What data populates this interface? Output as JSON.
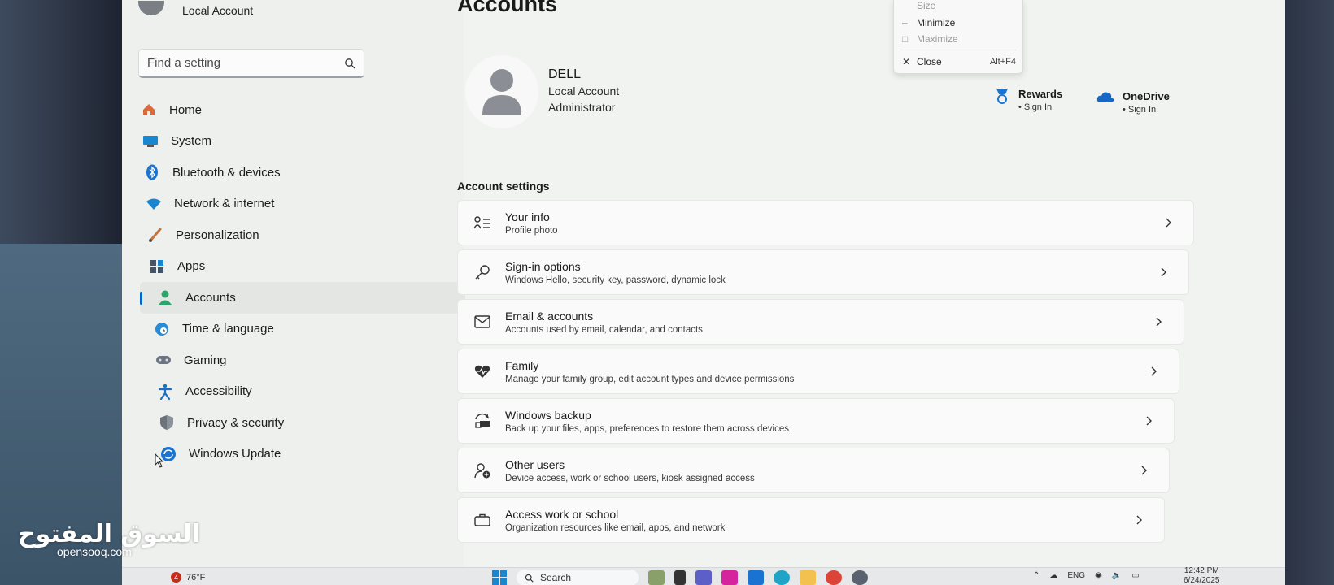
{
  "header_account": {
    "label": "Local Account"
  },
  "search": {
    "placeholder": "Find a setting"
  },
  "nav": {
    "items": [
      {
        "label": "Home",
        "icon": "home-icon"
      },
      {
        "label": "System",
        "icon": "monitor-icon"
      },
      {
        "label": "Bluetooth & devices",
        "icon": "bluetooth-icon"
      },
      {
        "label": "Network & internet",
        "icon": "wifi-icon"
      },
      {
        "label": "Personalization",
        "icon": "brush-icon"
      },
      {
        "label": "Apps",
        "icon": "apps-icon"
      },
      {
        "label": "Accounts",
        "icon": "person-icon",
        "active": true
      },
      {
        "label": "Time & language",
        "icon": "globe-clock-icon"
      },
      {
        "label": "Gaming",
        "icon": "gamepad-icon"
      },
      {
        "label": "Accessibility",
        "icon": "accessibility-icon"
      },
      {
        "label": "Privacy & security",
        "icon": "shield-icon"
      },
      {
        "label": "Windows Update",
        "icon": "refresh-icon"
      }
    ]
  },
  "page": {
    "title": "Accounts"
  },
  "profile": {
    "name": "DELL",
    "type": "Local Account",
    "role": "Administrator"
  },
  "services": [
    {
      "title": "Rewards",
      "subtitle": "• Sign In",
      "icon": "rewards-medal-icon"
    },
    {
      "title": "OneDrive",
      "subtitle": "• Sign In",
      "icon": "cloud-icon"
    }
  ],
  "section": {
    "title": "Account settings"
  },
  "cards": [
    {
      "title": "Your info",
      "subtitle": "Profile photo",
      "icon": "person-details-icon"
    },
    {
      "title": "Sign-in options",
      "subtitle": "Windows Hello, security key, password, dynamic lock",
      "icon": "key-icon"
    },
    {
      "title": "Email & accounts",
      "subtitle": "Accounts used by email, calendar, and contacts",
      "icon": "mail-icon"
    },
    {
      "title": "Family",
      "subtitle": "Manage your family group, edit account types and device permissions",
      "icon": "heart-family-icon"
    },
    {
      "title": "Windows backup",
      "subtitle": "Back up your files, apps, preferences to restore them across devices",
      "icon": "backup-icon"
    },
    {
      "title": "Other users",
      "subtitle": "Device access, work or school users, kiosk assigned access",
      "icon": "add-user-icon"
    },
    {
      "title": "Access work or school",
      "subtitle": "Organization resources like email, apps, and network",
      "icon": "briefcase-icon"
    }
  ],
  "context_menu": {
    "size": "Size",
    "minimize": "Minimize",
    "maximize": "Maximize",
    "close": "Close",
    "close_shortcut": "Alt+F4"
  },
  "taskbar": {
    "weather": "76°F",
    "weather_badge": "4",
    "search": "Search",
    "language": "ENG",
    "time": "12:42 PM",
    "date": "6/24/2025"
  },
  "watermark": {
    "arabic": "السوق المفتوح",
    "site": "opensooq.com"
  },
  "colors": {
    "accent": "#0067c0",
    "window_bg": "#f1f3f1"
  }
}
